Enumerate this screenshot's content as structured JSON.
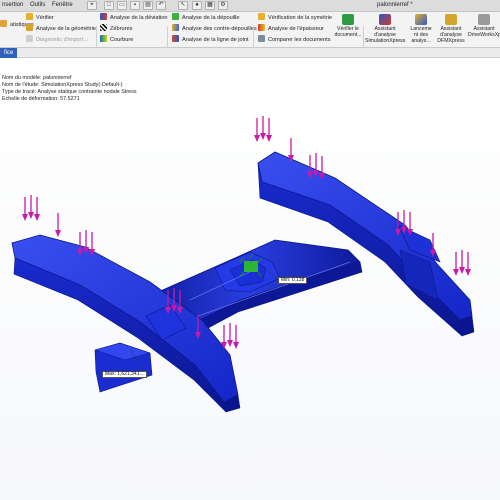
{
  "window": {
    "title": "palonnierref *"
  },
  "menu": [
    {
      "label": "nsertion"
    },
    {
      "label": "Outils"
    },
    {
      "label": "Fenêtre"
    }
  ],
  "ribbon": {
    "col1": {
      "left_label": "atistiques",
      "verify": "Vérifier",
      "geometry_analysis": "Analyse de la géométrie",
      "import_diagnostic": "Diagnostic d'import..."
    },
    "col2": {
      "deviation": "Analyse de la déviation",
      "zebra": "Zébrures",
      "curvature": "Courbure"
    },
    "col3": {
      "draft": "Analyse de la dépouille",
      "undercut": "Analyse des contre-dépouilles",
      "parting_line": "Analyse de la ligne de joint"
    },
    "col4": {
      "symmetry": "Vérification de la symétrie",
      "thickness": "Analyse de l'épaisseur",
      "compare": "Comparer les documents"
    },
    "check_document": "Vérifier le document...",
    "big_buttons": [
      {
        "label": "Assistant d'analyse SimulationXpress"
      },
      {
        "label": "Lanceme nt des analys..."
      },
      {
        "label": "Assistant d'analyse DFMXpress"
      },
      {
        "label": "Assistant DriveWorksXp"
      }
    ]
  },
  "tabs": [
    {
      "label": "fice"
    }
  ],
  "study_info": {
    "line1": "Nom du modèle: palonnierref",
    "line2": "Nom de l'étude: SimulationXpress Study(-Default-)",
    "line3": "Type de tracé: Analyse statique contrainte nodale Stress",
    "line4": "Echelle de déformation: 57.5271"
  },
  "probes": {
    "min": {
      "label": "Min:",
      "value": "0.138"
    },
    "max": {
      "label": "Max:",
      "value": "1,621,341..."
    }
  },
  "colors": {
    "model_blue": "#1b2fd6",
    "model_dark": "#0a1690",
    "load_arrow": "#c81aa8",
    "fixture": "#2ecc1a",
    "tab_active": "#2f63b9"
  },
  "icons": [
    "statistics-icon",
    "verify-icon",
    "geometry-analysis-icon",
    "import-diagnostic-icon",
    "deviation-icon",
    "zebra-icon",
    "curvature-icon",
    "draft-icon",
    "undercut-icon",
    "parting-line-icon",
    "symmetry-icon",
    "thickness-icon",
    "compare-icon",
    "check-document-icon",
    "simulationxpress-icon",
    "launch-analysis-icon",
    "dfmxpress-icon",
    "driveworks-icon"
  ]
}
